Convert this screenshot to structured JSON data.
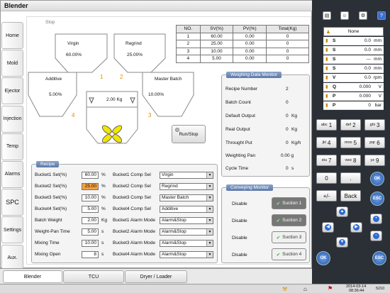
{
  "app": {
    "title": "Blender"
  },
  "status": {
    "stop": "Stop",
    "date": "2014-03-14",
    "time": "08:36:44",
    "code": "5210"
  },
  "nav": [
    "Home",
    "Mold",
    "Ejector",
    "Injection",
    "Temp",
    "Alarms",
    "SPC",
    "Settings",
    "Aux."
  ],
  "hoppers": {
    "virgin": {
      "name": "Virgin",
      "pct": "60.00%",
      "num": "1"
    },
    "regrind": {
      "name": "Regrind",
      "pct": "25.00%",
      "num": "2"
    },
    "additive": {
      "name": "Additive",
      "pct": "5.00%",
      "num": "4"
    },
    "master": {
      "name": "Master Batch",
      "pct": "10.00%",
      "num": "3"
    },
    "weight": "2.00 Kg"
  },
  "run_stop": "Run/Stop",
  "sv_table": {
    "headers": [
      "NO.",
      "SV(%)",
      "PV(%)",
      "Total(Kg)"
    ],
    "rows": [
      [
        "1",
        "60.00",
        "0.00",
        "0"
      ],
      [
        "2",
        "25.00",
        "0.00",
        "0"
      ],
      [
        "3",
        "10.00",
        "0.00",
        "0"
      ],
      [
        "4",
        "5.00",
        "0.00",
        "0"
      ]
    ]
  },
  "weighing": {
    "title": "Weighing Data Monitor",
    "rows": [
      [
        "Recipe Number",
        "2",
        ""
      ],
      [
        "Batch Count",
        "0",
        ""
      ],
      [
        "Default Output",
        "0",
        "Kg"
      ],
      [
        "Real Output",
        "0",
        "Kg"
      ],
      [
        "Throught Put",
        "0",
        "Kg/h"
      ],
      [
        "Weighting Pan",
        "0.00 g",
        ""
      ],
      [
        "Cycle Time",
        "0",
        "s"
      ]
    ]
  },
  "conveying": {
    "title": "Conveying Monitor",
    "rows": [
      {
        "label": "Disable",
        "btn": "Suction 1",
        "on": true
      },
      {
        "label": "Disable",
        "btn": "Suction 2",
        "on": true
      },
      {
        "label": "Disable",
        "btn": "Suction 3",
        "on": false
      },
      {
        "label": "Disable",
        "btn": "Suction 4",
        "on": false
      }
    ]
  },
  "recipe": {
    "title": "Recipe",
    "sets": [
      {
        "label": "Bucket1 Set(%)",
        "value": "60.00",
        "unit": "%"
      },
      {
        "label": "Bucket2 Set(%)",
        "value": "25.00",
        "unit": "%"
      },
      {
        "label": "Bucket3 Set(%)",
        "value": "10.00",
        "unit": "%"
      },
      {
        "label": "Bucket4 Set(%)",
        "value": "5.00",
        "unit": "%"
      },
      {
        "label": "Batch Weight",
        "value": "2.00",
        "unit": "Kg"
      },
      {
        "label": "Weight-Pan Time",
        "value": "5.00",
        "unit": "s"
      },
      {
        "label": "Mixing Time",
        "value": "10.00",
        "unit": "s"
      },
      {
        "label": "Mixing Open",
        "value": "8",
        "unit": "s"
      }
    ],
    "selects": [
      {
        "label": "Bucket1 Comp Sel",
        "value": "Virgin"
      },
      {
        "label": "Bucket2 Comp Sel",
        "value": "Regrind"
      },
      {
        "label": "Bucket3 Comp Sel",
        "value": "Master Batch"
      },
      {
        "label": "Bucket4 Comp Sel",
        "value": "Additive"
      },
      {
        "label": "Bucket1 Alarm Mode",
        "value": "Alarm&Stop"
      },
      {
        "label": "Bucket2 Alarm Mode",
        "value": "Alarm&Stop"
      },
      {
        "label": "Bucket3 Alarm Mode",
        "value": "Alarm&Stop"
      },
      {
        "label": "Bucket4 Alarm Mode",
        "value": "Alarm&Stop"
      }
    ]
  },
  "tabs": [
    "Blender",
    "TCU",
    "Dryer / Loader"
  ],
  "side_status": {
    "header": "None",
    "rows": [
      [
        "S",
        "0.0",
        "mm"
      ],
      [
        "S",
        "0.0",
        "mm"
      ],
      [
        "S",
        "---",
        "mm"
      ],
      [
        "S",
        "0.0",
        "mm"
      ],
      [
        "V",
        "0.0",
        "rpm"
      ],
      [
        "Q",
        "0.000",
        "V"
      ],
      [
        "P",
        "0.000",
        "V"
      ],
      [
        "P",
        "0",
        "bar"
      ]
    ]
  },
  "keypad": {
    "keys": [
      [
        "abc",
        "1"
      ],
      [
        "def",
        "2"
      ],
      [
        "ghi",
        "3"
      ],
      [
        "jkl",
        "4"
      ],
      [
        "mno",
        "5"
      ],
      [
        "pqr",
        "6"
      ],
      [
        "stu",
        "7"
      ],
      [
        "vwx",
        "8"
      ],
      [
        "yz",
        "9"
      ],
      [
        "",
        "0"
      ],
      [
        "",
        "."
      ],
      [
        "",
        "+/-"
      ],
      [
        "",
        "Back"
      ]
    ],
    "ok": "OK",
    "esc": "ESC"
  },
  "colors": {
    "accent": "#5d79a8",
    "highlight": "#f4a040",
    "fan": "#f2e600",
    "bg_dark": "#2b2f36"
  }
}
